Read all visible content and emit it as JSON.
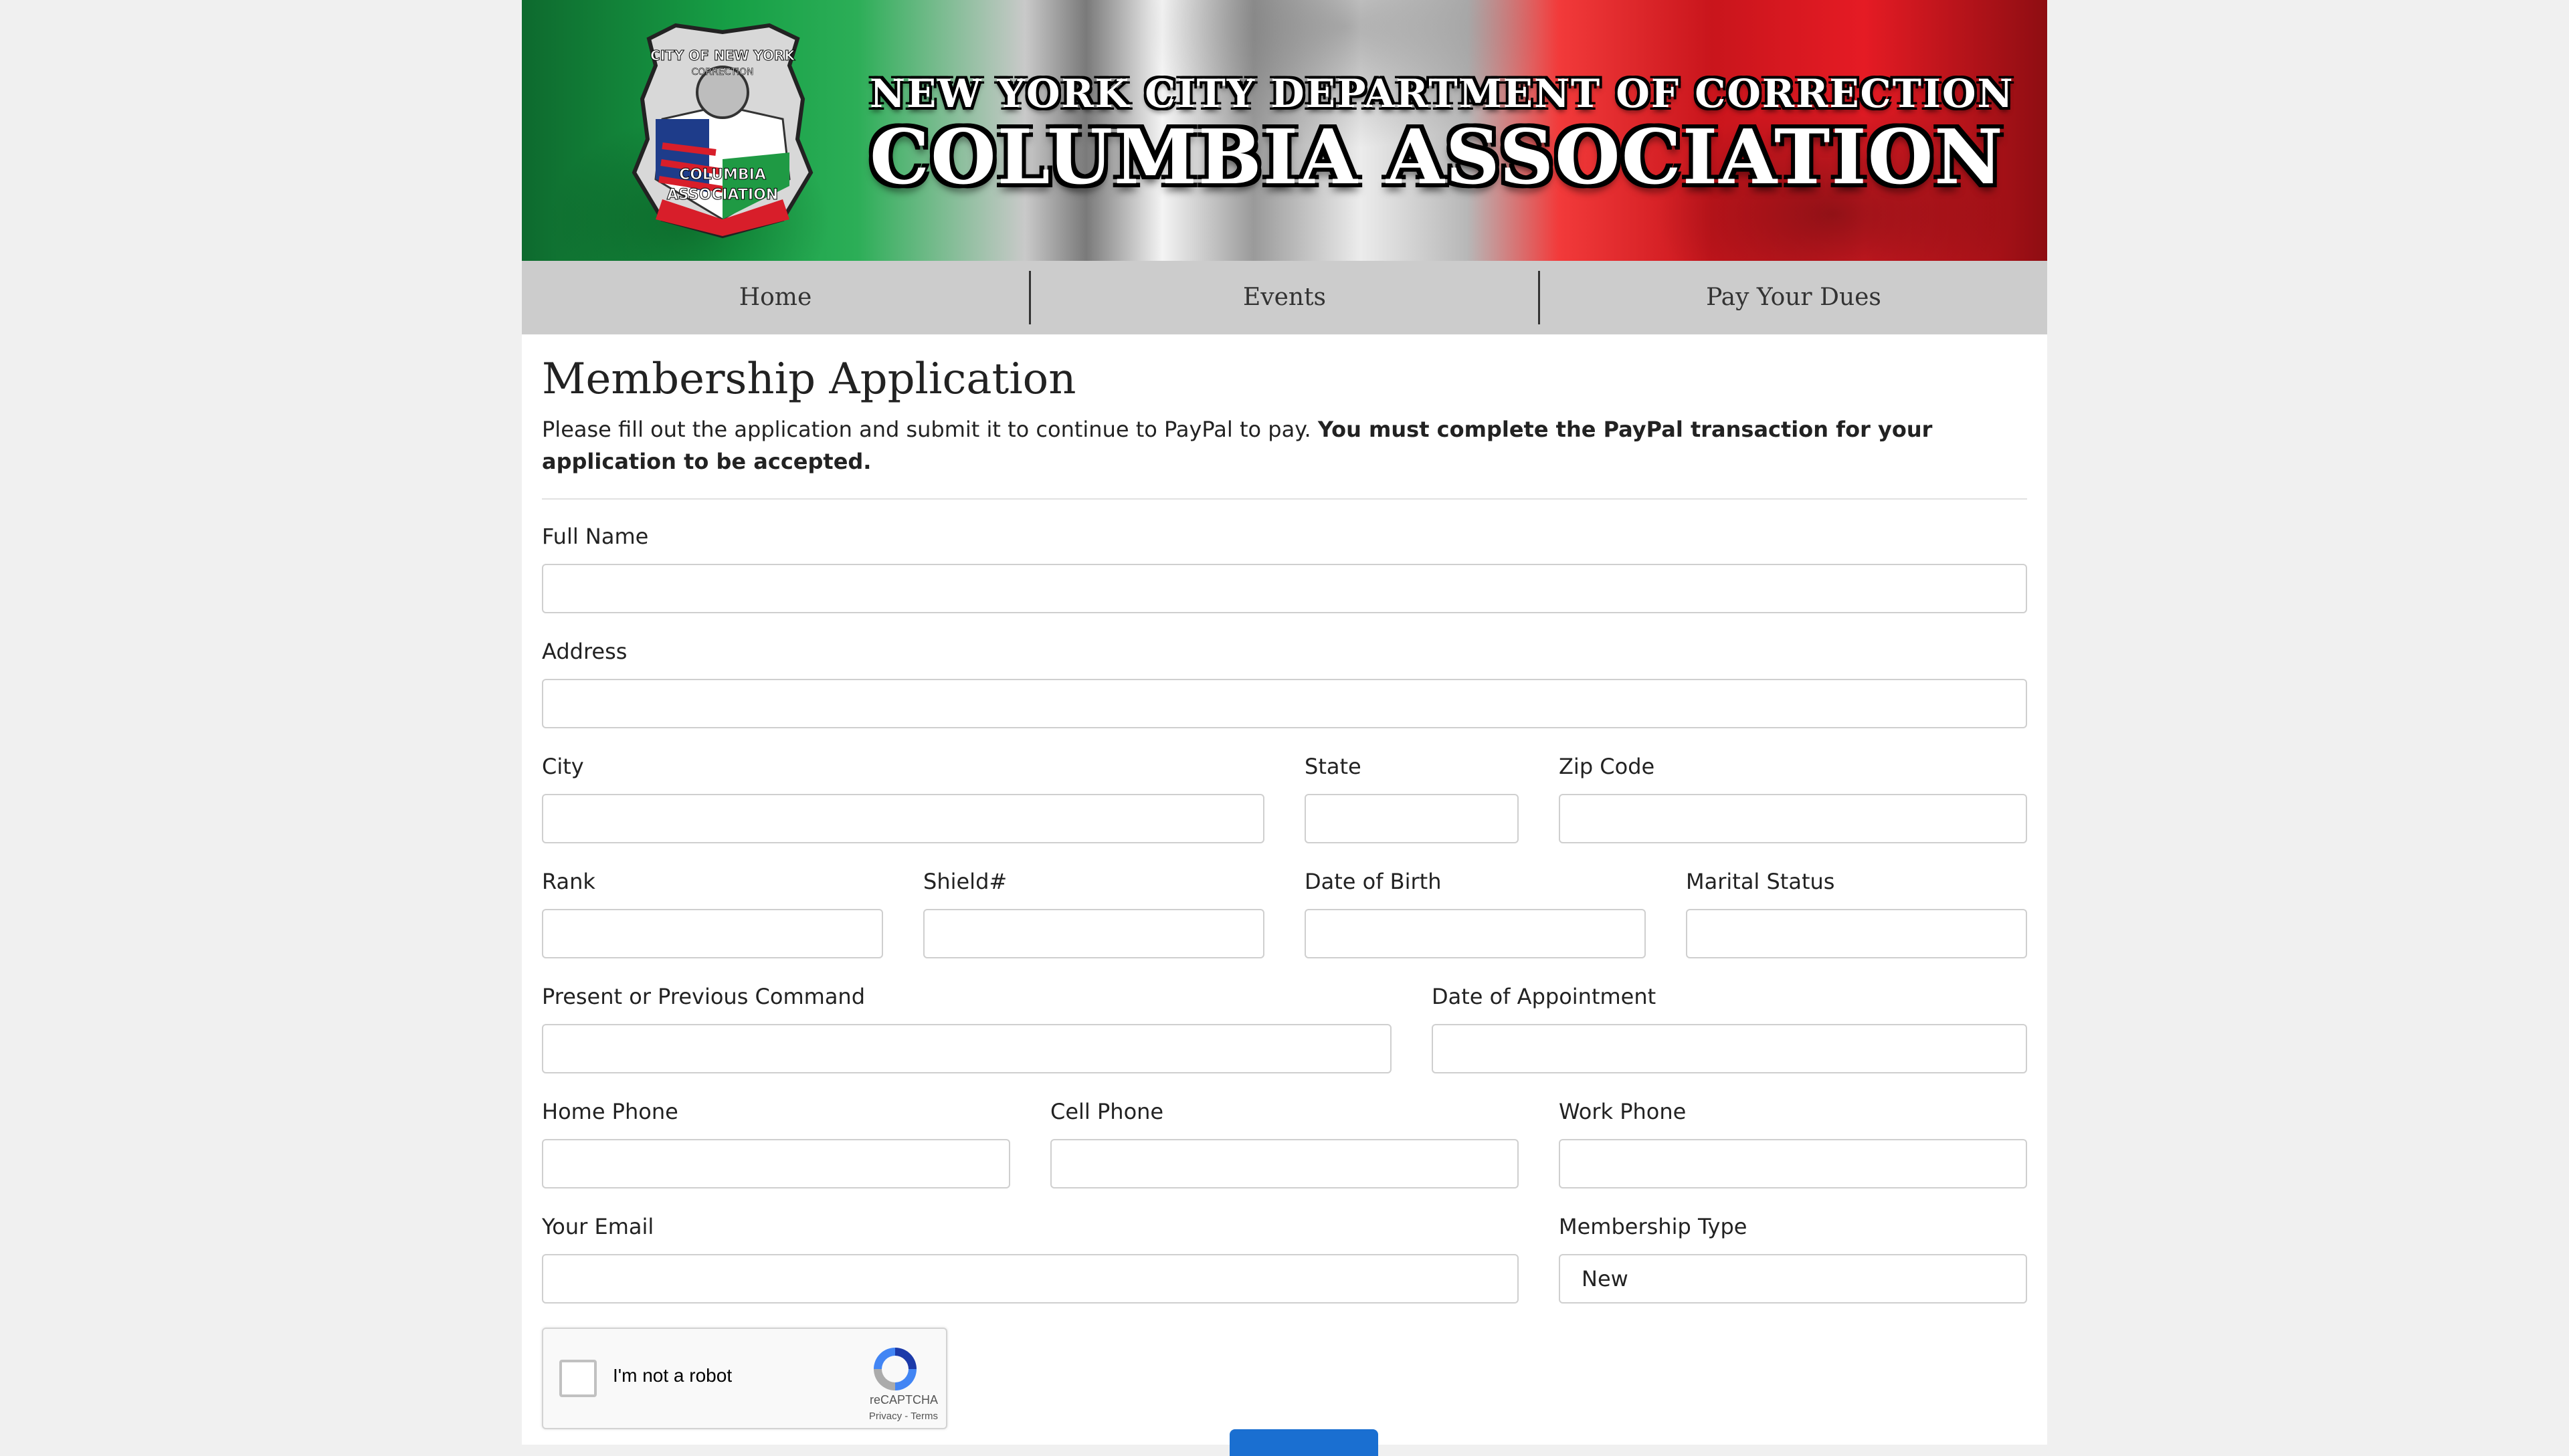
{
  "banner": {
    "line1": "NEW YORK CITY DEPARTMENT OF CORRECTION",
    "line2": "COLUMBIA ASSOCIATION",
    "badge_text_top": "CITY OF NEW YORK",
    "badge_text_mid": "CORRECTION",
    "badge_text_bottom_1": "COLUMBIA",
    "badge_text_bottom_2": "ASSOCIATION"
  },
  "nav": {
    "items": [
      {
        "label": "Home"
      },
      {
        "label": "Events"
      },
      {
        "label": "Pay Your Dues"
      }
    ]
  },
  "form": {
    "title": "Membership Application",
    "intro": "Please fill out the application and submit it to continue to PayPal to pay.",
    "intro_bold": "You must complete the PayPal transaction for your application to be accepted.",
    "fields": {
      "full_name": {
        "label": "Full Name",
        "value": ""
      },
      "address": {
        "label": "Address",
        "value": ""
      },
      "city": {
        "label": "City",
        "value": ""
      },
      "state": {
        "label": "State",
        "value": ""
      },
      "zip": {
        "label": "Zip Code",
        "value": ""
      },
      "rank": {
        "label": "Rank",
        "value": ""
      },
      "shield": {
        "label": "Shield#",
        "value": ""
      },
      "dob": {
        "label": "Date of Birth",
        "value": ""
      },
      "marital": {
        "label": "Marital Status",
        "value": ""
      },
      "command": {
        "label": "Present or Previous Command",
        "value": ""
      },
      "appointment": {
        "label": "Date of Appointment",
        "value": ""
      },
      "home_phone": {
        "label": "Home Phone",
        "value": ""
      },
      "cell_phone": {
        "label": "Cell Phone",
        "value": ""
      },
      "work_phone": {
        "label": "Work Phone",
        "value": ""
      },
      "email": {
        "label": "Your Email",
        "value": ""
      },
      "membership_type": {
        "label": "Membership Type",
        "value": "New"
      }
    }
  },
  "captcha": {
    "label": "I'm not a robot",
    "brand": "reCAPTCHA",
    "links": "Privacy - Terms"
  },
  "colors": {
    "nav_bg": "#cccccc",
    "submit_blue": "#1a6fd1",
    "page_bg": "#f0f0f0"
  }
}
